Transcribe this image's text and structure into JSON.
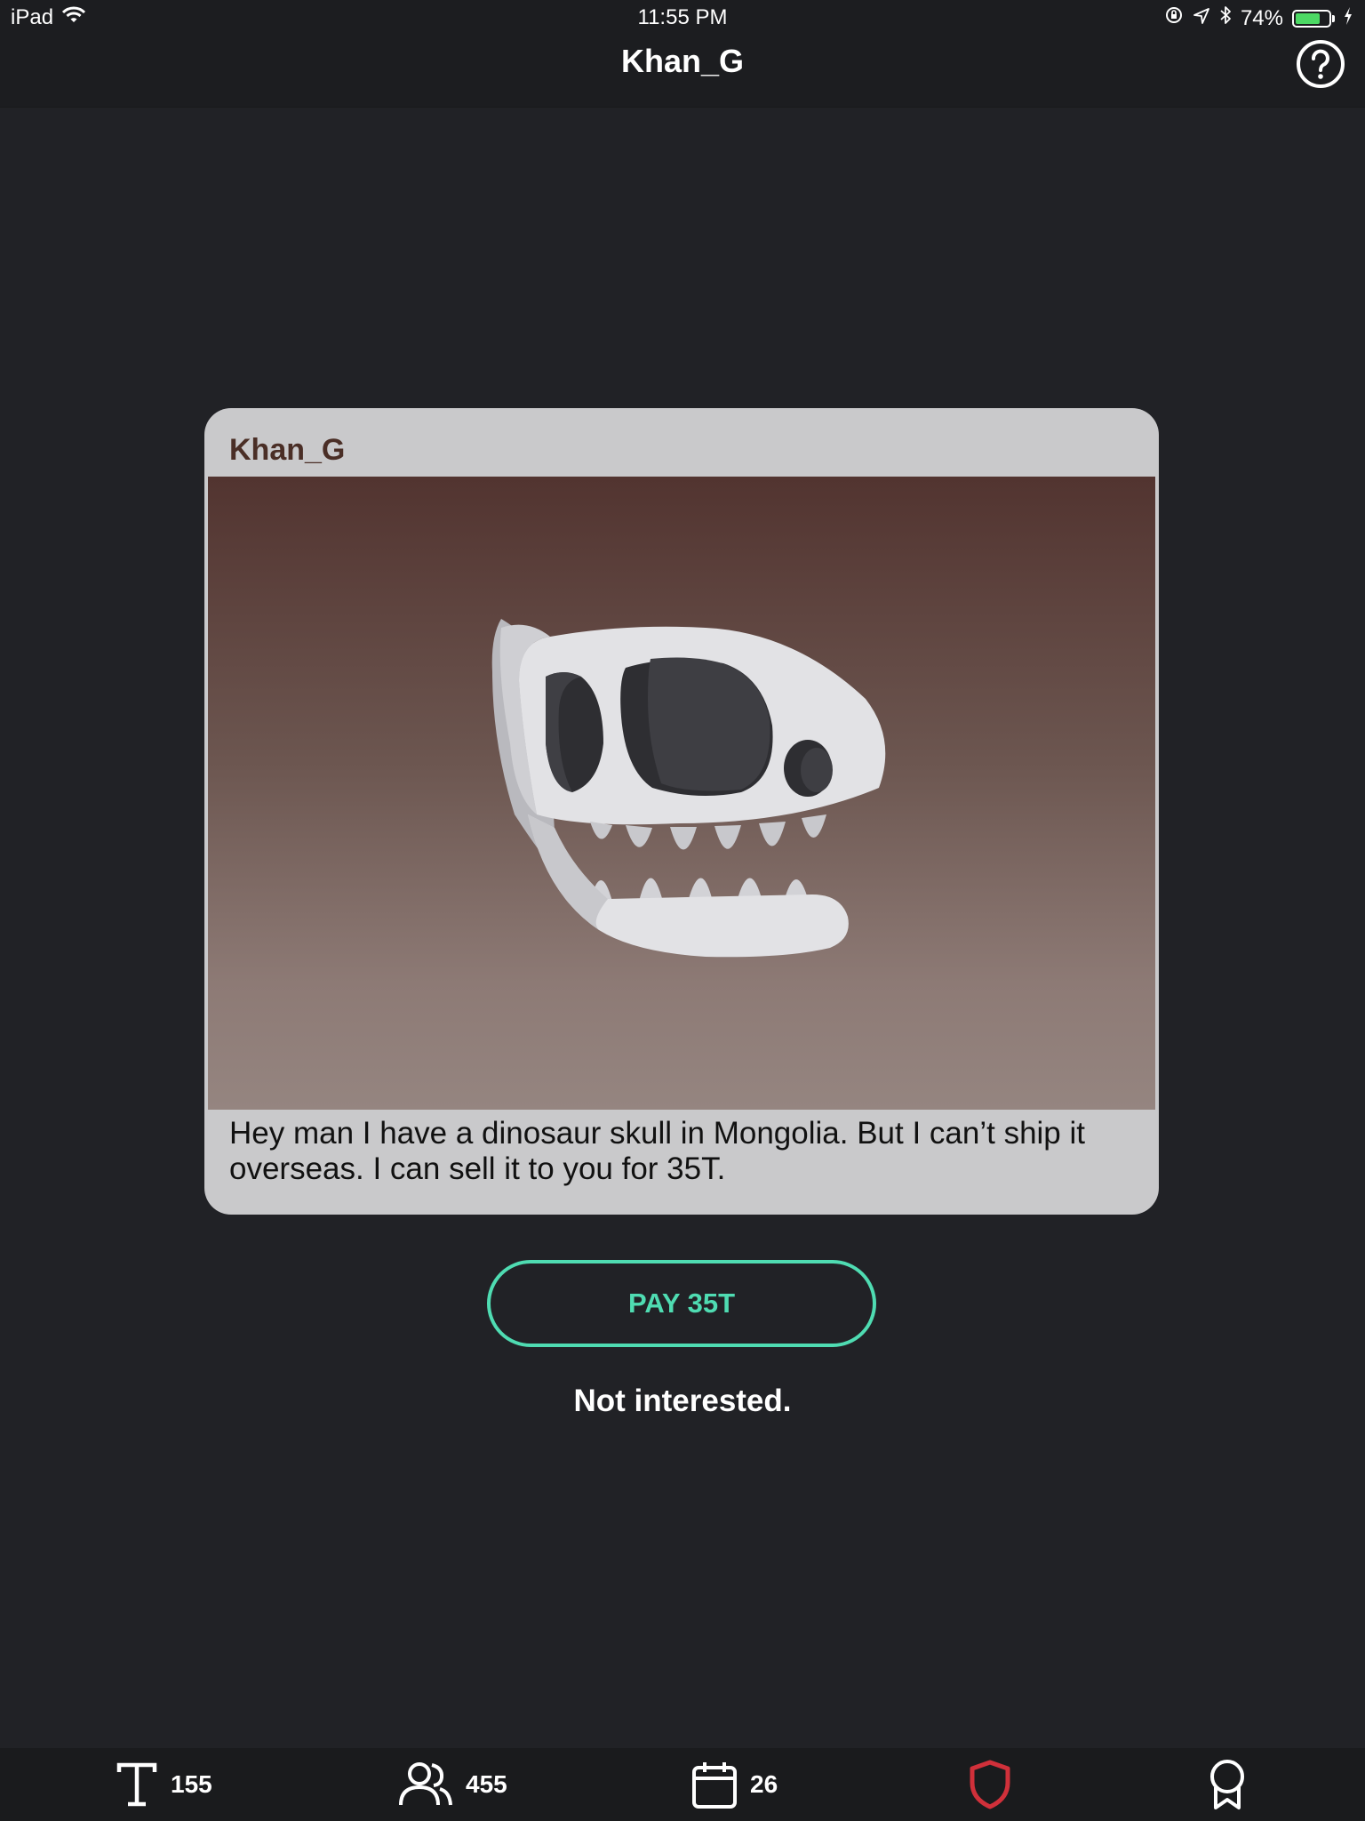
{
  "status_bar": {
    "device": "iPad",
    "time": "11:55 PM",
    "battery": "74%",
    "battery_level": 0.74
  },
  "nav": {
    "title": "Khan_G",
    "help_icon": "question-circle-icon"
  },
  "card": {
    "sender": "Khan_G",
    "image_icon": "dinosaur-skull-icon",
    "message": "Hey man I have a dinosaur skull in Mongolia. But I can’t ship it overseas. I can sell it to you for 35T."
  },
  "actions": {
    "pay_label": "PAY 35T",
    "decline_label": "Not interested."
  },
  "tabs": [
    {
      "icon": "tokens-t-icon",
      "count": "155"
    },
    {
      "icon": "people-icon",
      "count": "455"
    },
    {
      "icon": "calendar-icon",
      "count": "26"
    },
    {
      "icon": "shield-icon"
    },
    {
      "icon": "award-ribbon-icon"
    }
  ],
  "colors": {
    "background": "#212226",
    "accent": "#4fdcb2",
    "card": "#c9c9cb",
    "sender": "#4a2e26",
    "shield": "#d0303a",
    "battery": "#4cd964"
  }
}
